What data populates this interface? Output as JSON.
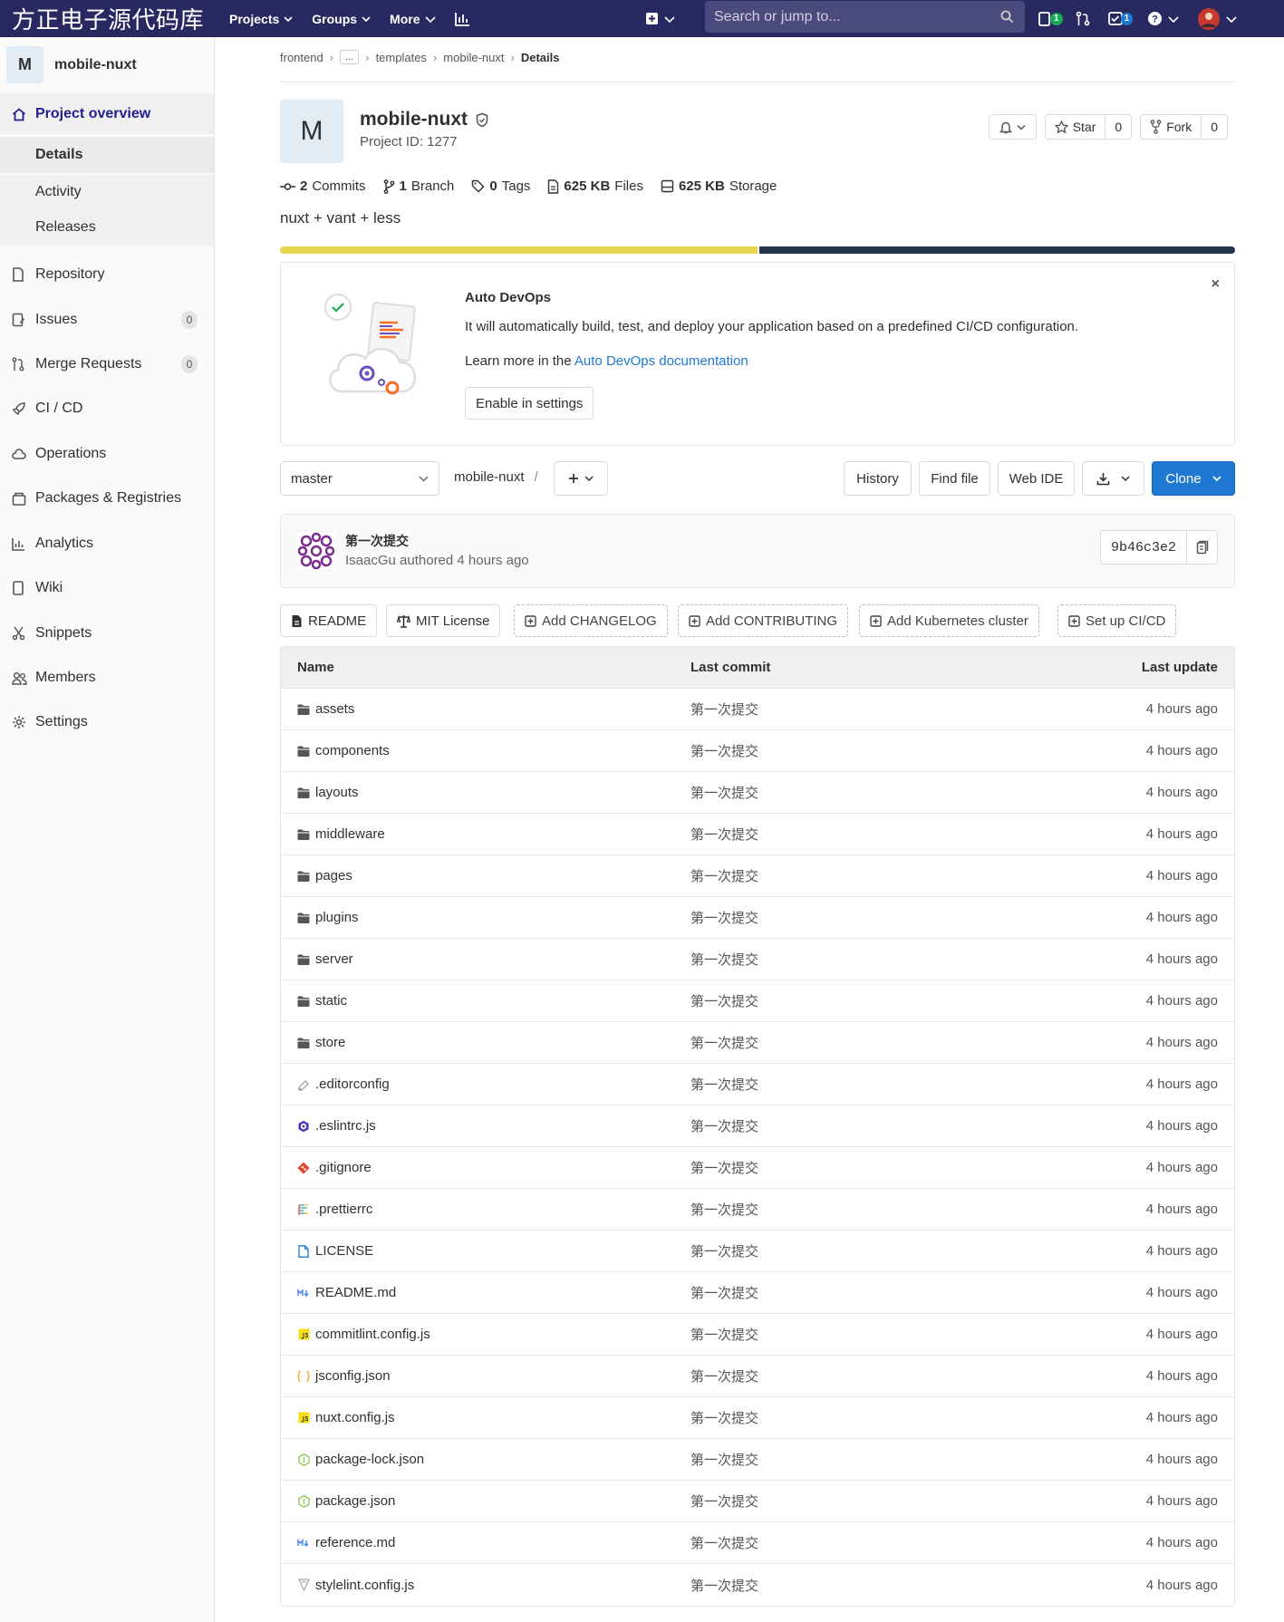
{
  "topbar": {
    "brand": "方正电子源代码库",
    "nav": [
      "Projects",
      "Groups",
      "More"
    ],
    "search_placeholder": "Search or jump to...",
    "issues_badge": "1",
    "todos_badge": "1"
  },
  "sidebar": {
    "avatar_letter": "M",
    "project_name": "mobile-nuxt",
    "overview": "Project overview",
    "sub": [
      "Details",
      "Activity",
      "Releases"
    ],
    "items": [
      {
        "label": "Repository",
        "icon": "doc-icon"
      },
      {
        "label": "Issues",
        "icon": "issues-icon",
        "count": "0"
      },
      {
        "label": "Merge Requests",
        "icon": "merge-request-icon",
        "count": "0"
      },
      {
        "label": "CI / CD",
        "icon": "rocket-icon"
      },
      {
        "label": "Operations",
        "icon": "cloud-icon"
      },
      {
        "label": "Packages & Registries",
        "icon": "package-icon"
      },
      {
        "label": "Analytics",
        "icon": "chart-icon"
      },
      {
        "label": "Wiki",
        "icon": "book-icon"
      },
      {
        "label": "Snippets",
        "icon": "scissors-icon"
      },
      {
        "label": "Members",
        "icon": "users-icon"
      },
      {
        "label": "Settings",
        "icon": "gear-icon"
      }
    ]
  },
  "breadcrumb": [
    "frontend",
    "...",
    "templates",
    "mobile-nuxt",
    "Details"
  ],
  "project": {
    "avatar_letter": "M",
    "name": "mobile-nuxt",
    "id_text": "Project ID: 1277",
    "star_label": "Star",
    "star_count": "0",
    "fork_label": "Fork",
    "fork_count": "0",
    "stats": {
      "commits_num": "2",
      "commits_label": "Commits",
      "branch_num": "1",
      "branch_label": "Branch",
      "tags_num": "0",
      "tags_label": "Tags",
      "files_num": "625 KB",
      "files_label": "Files",
      "storage_num": "625 KB",
      "storage_label": "Storage"
    },
    "description": "nuxt + vant + less",
    "languages": [
      {
        "color": "#e8d44d",
        "fraction": 0.5
      },
      {
        "color": "#243446",
        "fraction": 0.5
      }
    ]
  },
  "devops": {
    "title": "Auto DevOps",
    "description": "It will automatically build, test, and deploy your application based on a predefined CI/CD configuration.",
    "learn_prefix": "Learn more in the ",
    "learn_link": "Auto DevOps documentation",
    "button": "Enable in settings",
    "close": "×"
  },
  "toolbar": {
    "branch": "master",
    "path": "mobile-nuxt",
    "path_sep": "/",
    "history": "History",
    "find_file": "Find file",
    "web_ide": "Web IDE",
    "clone": "Clone"
  },
  "last_commit": {
    "title": "第一次提交",
    "author_line": "IsaacGu authored 4 hours ago",
    "sha": "9b46c3e2"
  },
  "quick_actions": [
    "README",
    "MIT License",
    "Add CHANGELOG",
    "Add CONTRIBUTING",
    "Add Kubernetes cluster",
    "Set up CI/CD"
  ],
  "tree": {
    "headers": {
      "name": "Name",
      "commit": "Last commit",
      "update": "Last update"
    },
    "rows": [
      {
        "name": "assets",
        "type": "folder",
        "commit": "第一次提交",
        "update": "4 hours ago"
      },
      {
        "name": "components",
        "type": "folder",
        "commit": "第一次提交",
        "update": "4 hours ago"
      },
      {
        "name": "layouts",
        "type": "folder",
        "commit": "第一次提交",
        "update": "4 hours ago"
      },
      {
        "name": "middleware",
        "type": "folder",
        "commit": "第一次提交",
        "update": "4 hours ago"
      },
      {
        "name": "pages",
        "type": "folder",
        "commit": "第一次提交",
        "update": "4 hours ago"
      },
      {
        "name": "plugins",
        "type": "folder",
        "commit": "第一次提交",
        "update": "4 hours ago"
      },
      {
        "name": "server",
        "type": "folder",
        "commit": "第一次提交",
        "update": "4 hours ago"
      },
      {
        "name": "static",
        "type": "folder",
        "commit": "第一次提交",
        "update": "4 hours ago"
      },
      {
        "name": "store",
        "type": "folder",
        "commit": "第一次提交",
        "update": "4 hours ago"
      },
      {
        "name": ".editorconfig",
        "type": "editorconfig",
        "commit": "第一次提交",
        "update": "4 hours ago"
      },
      {
        "name": ".eslintrc.js",
        "type": "eslint",
        "commit": "第一次提交",
        "update": "4 hours ago"
      },
      {
        "name": ".gitignore",
        "type": "git",
        "commit": "第一次提交",
        "update": "4 hours ago"
      },
      {
        "name": ".prettierrc",
        "type": "prettier",
        "commit": "第一次提交",
        "update": "4 hours ago"
      },
      {
        "name": "LICENSE",
        "type": "license",
        "commit": "第一次提交",
        "update": "4 hours ago"
      },
      {
        "name": "README.md",
        "type": "markdown",
        "commit": "第一次提交",
        "update": "4 hours ago"
      },
      {
        "name": "commitlint.config.js",
        "type": "js",
        "commit": "第一次提交",
        "update": "4 hours ago"
      },
      {
        "name": "jsconfig.json",
        "type": "json",
        "commit": "第一次提交",
        "update": "4 hours ago"
      },
      {
        "name": "nuxt.config.js",
        "type": "js",
        "commit": "第一次提交",
        "update": "4 hours ago"
      },
      {
        "name": "package-lock.json",
        "type": "node",
        "commit": "第一次提交",
        "update": "4 hours ago"
      },
      {
        "name": "package.json",
        "type": "node",
        "commit": "第一次提交",
        "update": "4 hours ago"
      },
      {
        "name": "reference.md",
        "type": "markdown",
        "commit": "第一次提交",
        "update": "4 hours ago"
      },
      {
        "name": "stylelint.config.js",
        "type": "stylelint",
        "commit": "第一次提交",
        "update": "4 hours ago"
      }
    ]
  }
}
